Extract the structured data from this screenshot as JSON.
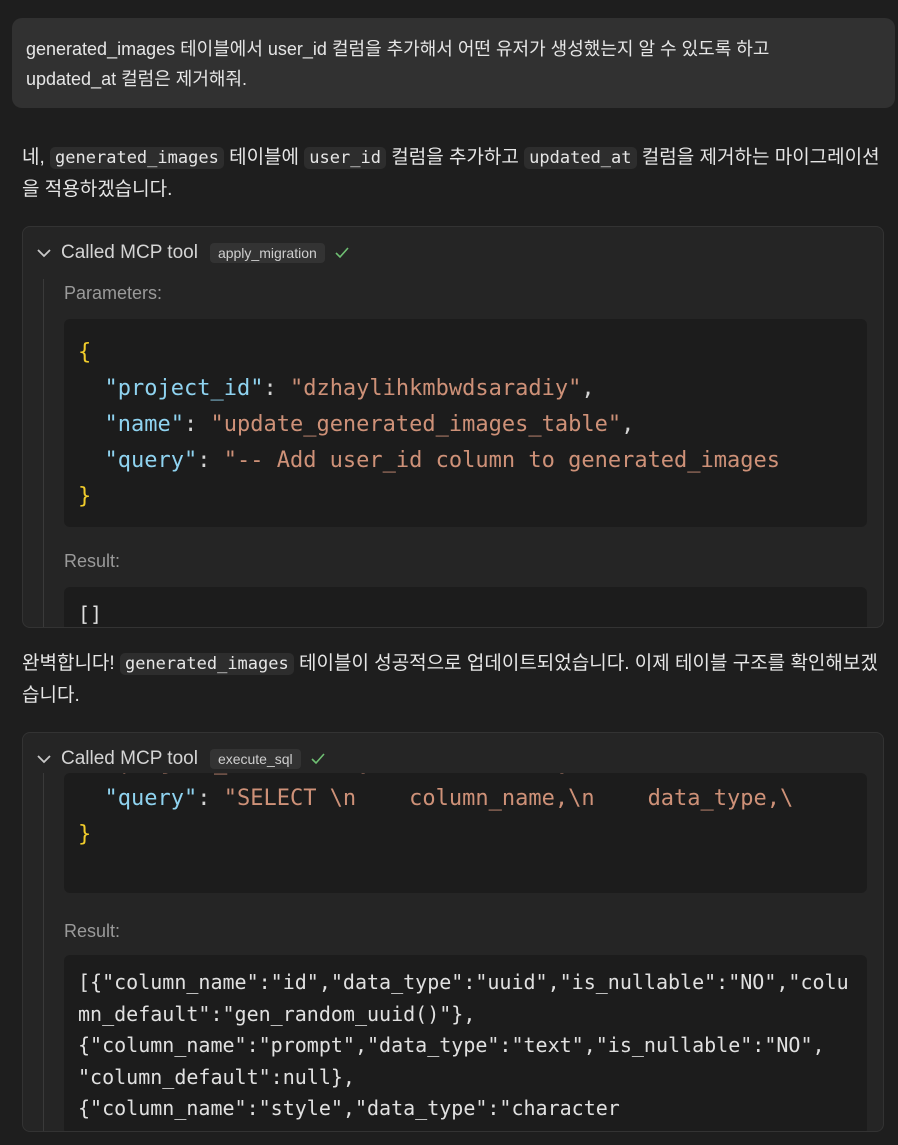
{
  "user_message": {
    "line1": "generated_images 테이블에서 user_id 컬럼을 추가해서 어떤 유저가 생성했는지 알 수 있도록 하고",
    "line2": "updated_at 컬럼은 제거해줘."
  },
  "assistant_msg1": {
    "prefix": "네, ",
    "code1": "generated_images",
    "mid1": " 테이블에 ",
    "code2": "user_id",
    "mid2": " 컬럼을 추가하고 ",
    "code3": "updated_at",
    "suffix": " 컬럼을 제거하는 마이그레이션을 적용하겠습니다."
  },
  "tool1": {
    "header_label": "Called MCP tool",
    "tool_name": "apply_migration",
    "params_label": "Parameters:",
    "open_brace": "{",
    "close_brace": "}",
    "params": [
      {
        "key": "\"project_id\"",
        "value": "\"dzhaylihkmbwdsaradiy\"",
        "trail": ","
      },
      {
        "key": "\"name\"",
        "value": "\"update_generated_images_table\"",
        "trail": ","
      },
      {
        "key": "\"query\"",
        "value": "\"-- Add user_id column to generated_images",
        "trail": ""
      }
    ],
    "result_label": "Result:",
    "result_text": "[]"
  },
  "assistant_msg2": {
    "prefix": "완벽합니다! ",
    "code1": "generated_images",
    "suffix": " 테이블이 성공적으로 업데이트되었습니다. 이제 테이블 구조를 확인해보겠습니다."
  },
  "tool2": {
    "header_label": "Called MCP tool",
    "tool_name": "execute_sql",
    "partial_line": "\"project_id\": \"dzhaylihkmbwdsaradiy\",",
    "params": [
      {
        "key": "\"query\"",
        "value": "\"SELECT \\n    column_name,\\n    data_type,\\",
        "trail": ""
      }
    ],
    "close_brace": "}",
    "result_label": "Result:",
    "result_text": "[{\"column_name\":\"id\",\"data_type\":\"uuid\",\"is_nullable\":\"NO\",\"column_default\":\"gen_random_uuid()\"},\n{\"column_name\":\"prompt\",\"data_type\":\"text\",\"is_nullable\":\"NO\",\n\"column_default\":null},\n{\"column_name\":\"style\",\"data_type\":\"character"
  },
  "colors": {
    "background": "#1e1e1e",
    "brace": "#f2cd2b",
    "key": "#8fd3f0",
    "string": "#ce9178",
    "check": "#6fbf73"
  },
  "icons": [
    "chevron-down-icon",
    "check-icon"
  ]
}
